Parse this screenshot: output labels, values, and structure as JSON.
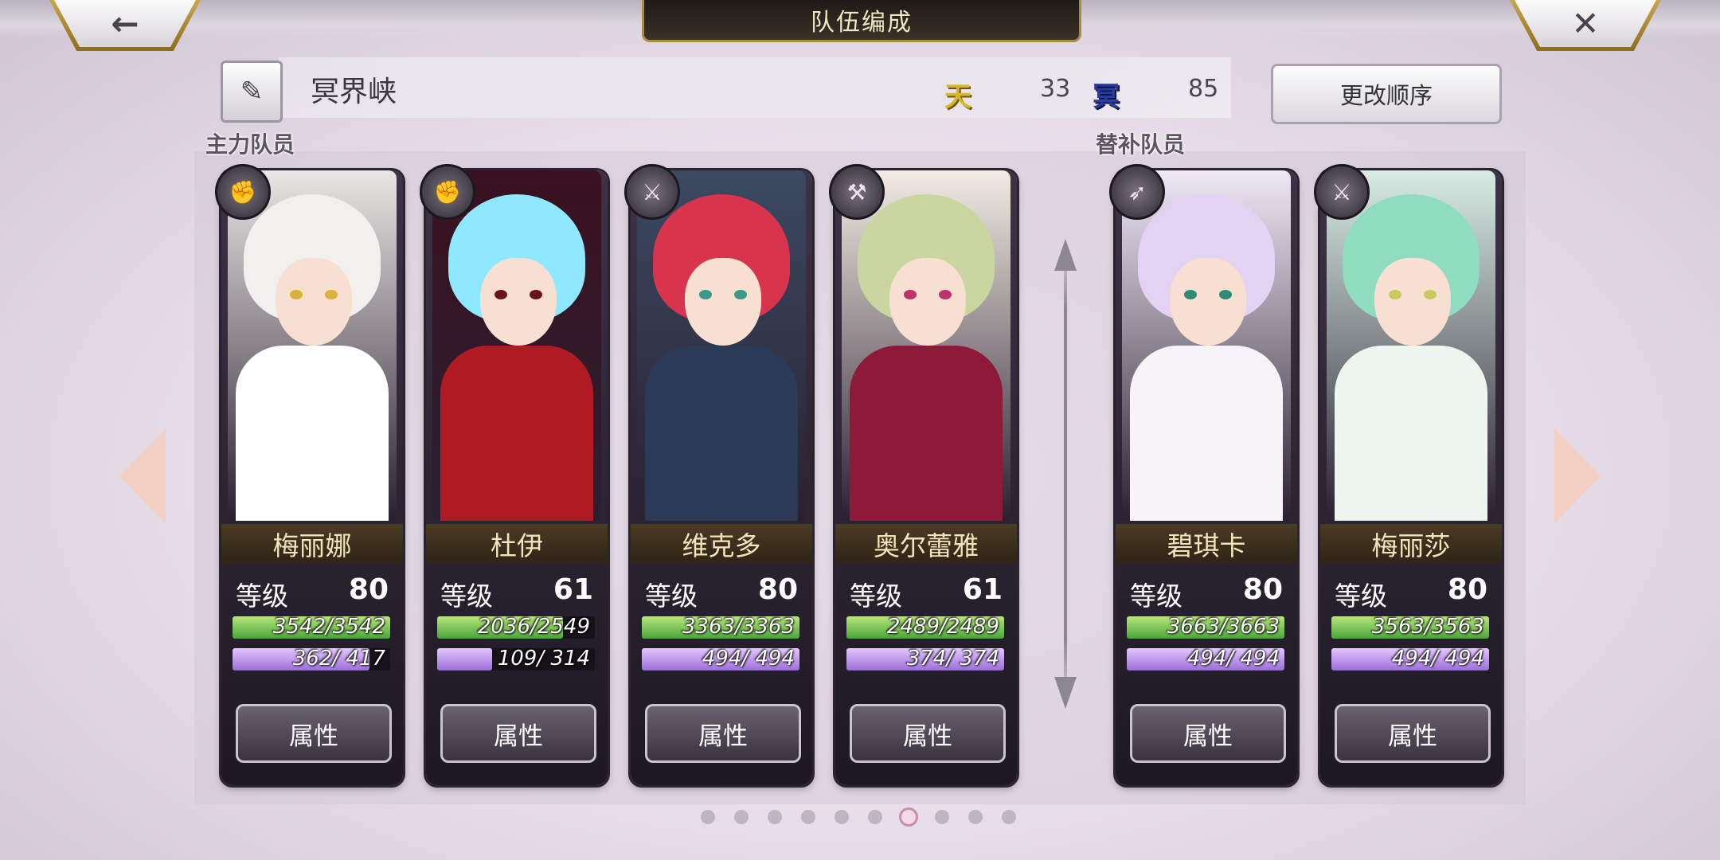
{
  "header": {
    "title": "队伍编成",
    "back_icon": "←",
    "close_icon": "✕"
  },
  "team": {
    "edit_icon": "✎",
    "name": "冥界峡",
    "resource1_icon": "天",
    "resource1_value": "33",
    "resource2_icon": "冥",
    "resource2_value": "85",
    "reorder_label": "更改顺序"
  },
  "sections": {
    "main_label": "主力队员",
    "sub_label": "替补队员"
  },
  "labels": {
    "level": "等级",
    "attr_button": "属性"
  },
  "members": [
    {
      "name": "梅丽娜",
      "level": "80",
      "hp": "3542/3542",
      "hp_ratio": 1.0,
      "mp": "362/ 417",
      "mp_ratio": 0.868,
      "class_icon": "fist-icon",
      "hair": "#f2f0ee",
      "body": "#ffffff",
      "eye": "#d9b23a",
      "bg": "#e9e6e4"
    },
    {
      "name": "杜伊",
      "level": "61",
      "hp": "2036/2549",
      "hp_ratio": 0.799,
      "mp": "109/ 314",
      "mp_ratio": 0.347,
      "class_icon": "fist-icon",
      "hair": "#8ee8ff",
      "body": "#b01a22",
      "eye": "#6a1418",
      "bg": "#3a1120"
    },
    {
      "name": "维克多",
      "level": "80",
      "hp": "3363/3363",
      "hp_ratio": 1.0,
      "mp": "494/ 494",
      "mp_ratio": 1.0,
      "class_icon": "sword-icon",
      "hair": "#d8344e",
      "body": "#2b3a56",
      "eye": "#3a9a8a",
      "bg": "#3b4a62"
    },
    {
      "name": "奥尔蕾雅",
      "level": "61",
      "hp": "2489/2489",
      "hp_ratio": 1.0,
      "mp": "374/ 374",
      "mp_ratio": 1.0,
      "class_icon": "axe-icon",
      "hair": "#c9d6a0",
      "body": "#8e1a3a",
      "eye": "#c0306a",
      "bg": "#f2ece4"
    },
    {
      "name": "碧琪卡",
      "level": "80",
      "hp": "3663/3663",
      "hp_ratio": 1.0,
      "mp": "494/ 494",
      "mp_ratio": 1.0,
      "class_icon": "bow-icon",
      "hair": "#e4d2f2",
      "body": "#f6f4f8",
      "eye": "#2e8b7a",
      "bg": "#efe8f6"
    },
    {
      "name": "梅丽莎",
      "level": "80",
      "hp": "3563/3563",
      "hp_ratio": 1.0,
      "mp": "494/ 494",
      "mp_ratio": 1.0,
      "class_icon": "sword-icon",
      "hair": "#8fdcc0",
      "body": "#eef4ee",
      "eye": "#c9c85a",
      "bg": "#d8ece4"
    }
  ],
  "pagination": {
    "count": 10,
    "active_index": 6
  }
}
